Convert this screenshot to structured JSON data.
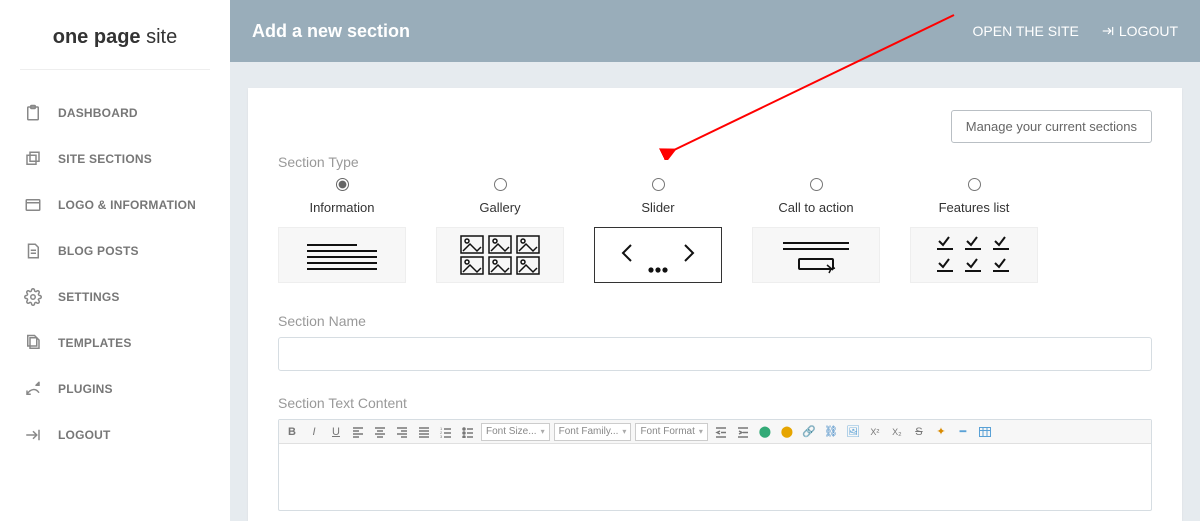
{
  "logo": {
    "bold": "one page",
    "light": " site"
  },
  "nav": [
    {
      "label": "DASHBOARD"
    },
    {
      "label": "SITE SECTIONS"
    },
    {
      "label": "LOGO & INFORMATION"
    },
    {
      "label": "BLOG POSTS"
    },
    {
      "label": "SETTINGS"
    },
    {
      "label": "TEMPLATES"
    },
    {
      "label": "PLUGINS"
    },
    {
      "label": "LOGOUT"
    }
  ],
  "topbar": {
    "title": "Add a new section",
    "open_site": "OPEN THE SITE",
    "logout": "LOGOUT"
  },
  "panel": {
    "manage_button": "Manage your current sections",
    "section_type_label": "Section Type",
    "types": [
      {
        "label": "Information"
      },
      {
        "label": "Gallery"
      },
      {
        "label": "Slider"
      },
      {
        "label": "Call to action"
      },
      {
        "label": "Features list"
      }
    ],
    "section_name_label": "Section Name",
    "section_name_value": "",
    "section_text_label": "Section Text Content",
    "editor": {
      "font_size": "Font Size...",
      "font_family": "Font Family...",
      "font_format": "Font Format"
    }
  }
}
